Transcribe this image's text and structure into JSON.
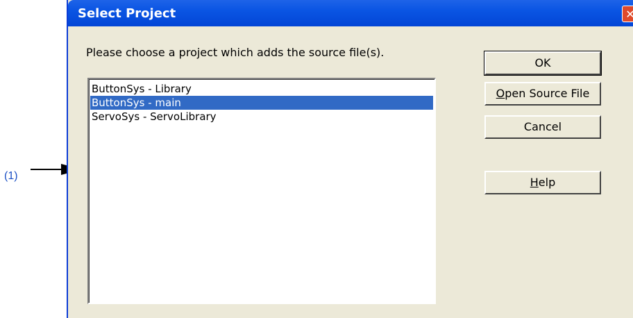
{
  "callout": {
    "label": "(1)"
  },
  "dialog": {
    "title": "Select Project",
    "prompt": "Please choose a project which adds the source file(s).",
    "projects": [
      {
        "label": "ButtonSys - Library",
        "selected": false
      },
      {
        "label": "ButtonSys - main",
        "selected": true
      },
      {
        "label": "ServoSys - ServoLibrary",
        "selected": false
      }
    ],
    "buttons": {
      "ok": "OK",
      "open_source_file": {
        "mnemonic": "O",
        "rest": "pen Source File"
      },
      "cancel": "Cancel",
      "help": {
        "mnemonic": "H",
        "rest": "elp"
      }
    },
    "close_icon": "close-icon"
  },
  "colors": {
    "titlebar": "#0a55e3",
    "selection": "#316ac5",
    "dialog_bg": "#ece9d8",
    "callout": "#1a4fc4"
  }
}
